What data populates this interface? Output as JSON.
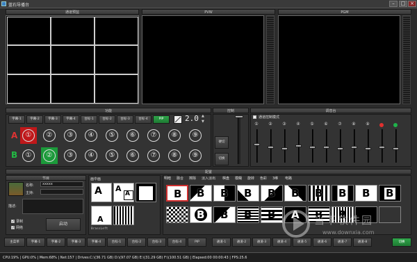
{
  "window": {
    "title": "蓝石导播台"
  },
  "panels": {
    "monitor_title": "通道预监",
    "pvw_title": "PVW",
    "pgm_title": "PGM",
    "function_title": "功能",
    "control_title": "控制",
    "mixer_title": "调音台",
    "config_title": "配置"
  },
  "function_buttons": [
    "字幕-1",
    "字幕-2",
    "字幕-3",
    "字幕-4",
    "台标-1",
    "台标-2",
    "台标-3",
    "台标-4",
    "PIP"
  ],
  "transition_value": "2.0",
  "row_a": {
    "label": "A",
    "items": [
      "①",
      "②",
      "③",
      "④",
      "⑤",
      "⑥",
      "⑦",
      "⑧",
      "⑨"
    ],
    "active_index": 0
  },
  "row_b": {
    "label": "B",
    "items": [
      "①",
      "②",
      "③",
      "④",
      "⑤",
      "⑥",
      "⑦",
      "⑧",
      "⑨"
    ],
    "active_index": 1
  },
  "control": {
    "cut_label": "硬切",
    "switch_label": "切换"
  },
  "mixer": {
    "mode_label": "通道控制模式",
    "channels": [
      "①",
      "②",
      "③",
      "④",
      "⑤",
      "⑥",
      "⑦",
      "⑧",
      "⑨"
    ],
    "knob_levels": [
      0.55,
      0.45,
      0.4,
      0.5,
      0.45,
      0.45,
      0.4,
      0.45,
      0.4,
      0.45,
      0.4
    ],
    "led_colors": [
      "#e0302f",
      "#1fb34a"
    ]
  },
  "program": {
    "title": "节目",
    "name_label": "名称:",
    "name_value": "xxxxx",
    "host_label": "主持:",
    "desc_label": "描述:",
    "record_label": "录制",
    "live_label": "网络",
    "start_label": "启动"
  },
  "pip": {
    "title": "画中画",
    "footer": "BrassLeft"
  },
  "effects": {
    "tabs": [
      "明暗",
      "融合",
      "擦除",
      "淡入淡出",
      "棋盘",
      "模糊",
      "旋转",
      "色彩",
      "3维",
      "电路"
    ],
    "thumbs_row1": [
      "B",
      "B",
      "B",
      "B",
      "B",
      "B",
      "B",
      "B",
      "B",
      "B"
    ],
    "thumbs_row2": [
      "",
      "B",
      "B",
      "B",
      "B",
      "A",
      "B",
      "B",
      "",
      ""
    ]
  },
  "bottom_buttons": [
    "主菜单",
    "字幕-1",
    "字幕-2",
    "字幕-3",
    "字幕-4",
    "台标-1",
    "台标-2",
    "台标-3",
    "台标-4",
    "PIP",
    "通道-1",
    "通道-2",
    "通道-3",
    "通道-4",
    "通道-5",
    "通道-6",
    "通道-7",
    "通道-8",
    "切换"
  ],
  "status": "CPU:19% | GPU:0% | Mem:68% | Net:157 | Drives:C:\\(36.71 GB)  D:\\(97.07 GB)  E:\\(31.29 GB)  F:\\(100.51 GB) | Elapsed:00 00:00:43 | FPS:25.6",
  "watermark": {
    "cn": "当下软件园",
    "url": "www.downxia.com"
  }
}
